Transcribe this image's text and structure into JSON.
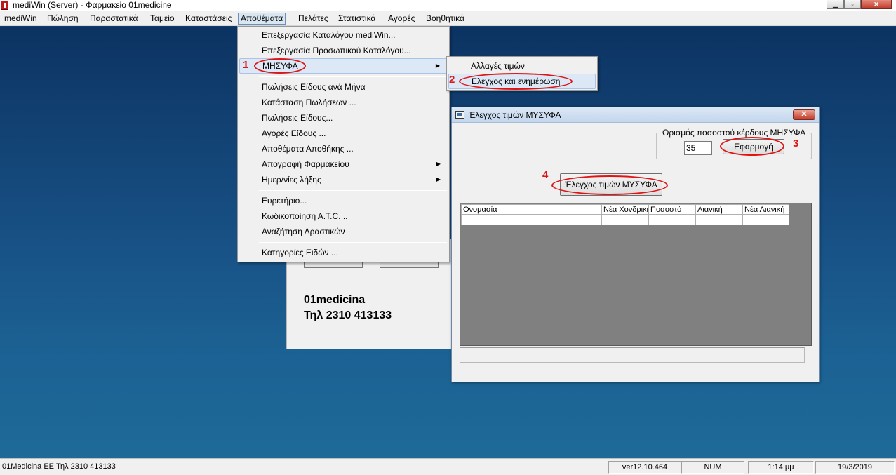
{
  "window": {
    "title": "mediWin (Server) - Φαρμακείο 01medicine",
    "controls": {
      "minimize": "▁",
      "maximize": "▫",
      "close": "✕"
    }
  },
  "menubar": {
    "items": [
      "mediWin",
      "Πώληση",
      "Παραστατικά",
      "Ταμείο",
      "Καταστάσεις",
      "Αποθέματα",
      "Πελάτες",
      "Στατιστικά",
      "Αγορές",
      "Βοηθητικά"
    ],
    "open_item": "Αποθέματα"
  },
  "dropdown": {
    "items": [
      "Επεξεργασία Καταλόγου mediWin...",
      "Επεξεργασία Προσωπικού Καταλόγου...",
      "ΜΗΣΥΦΑ",
      "Πωλήσεις Είδους ανά Μήνα",
      "Κατάσταση Πωλήσεων ...",
      "Πωλήσεις Είδους...",
      "Αγορές Είδους ...",
      "Αποθέματα Αποθήκης ...",
      "Απογραφή Φαρμακείου",
      "Ημερ/νίες λήξης",
      "Ευρετήριο...",
      "Κωδικοποίηση Α.Τ.C. ..",
      "Αναζήτηση Δραστικών",
      "Κατηγορίες Ειδών ..."
    ],
    "submenu_arrow": "▶"
  },
  "submenu": {
    "items": [
      "Αλλαγές τιμών",
      "Ελεγχος και ενημέρωση"
    ]
  },
  "dialog": {
    "title": "Έλεγχος τιμών ΜΥΣΥΦΑ",
    "close_label": "✕",
    "group_label": "Ορισμός ποσοστού κέρδους  ΜΗΣΥΦΑ",
    "percent_value": "35",
    "apply_button": "Εφαρμογή",
    "check_button": "Έλεγχος τιμών ΜΥΣΥΦΑ",
    "columns": [
      "Ονομασία",
      "Νέα Χονδρική",
      "Ποσοστό",
      "Λιανική",
      "Νέα Λιανική"
    ],
    "rows": [
      [
        "",
        "",
        "",
        "",
        ""
      ]
    ]
  },
  "background_window": {
    "company": "01medicina",
    "phone": "Τηλ 2310 413133"
  },
  "annotations": [
    "1",
    "2",
    "3",
    "4"
  ],
  "statusbar": {
    "company": "01Medicina EE    Τηλ 2310 413133",
    "version": "ver12.10.464",
    "num": "NUM",
    "time": "1:14 μμ",
    "date": "19/3/2019"
  },
  "colors": {
    "desktop": "#0f3e6a",
    "annotation": "#e01414",
    "menu_highlight": "#dce8f5"
  }
}
